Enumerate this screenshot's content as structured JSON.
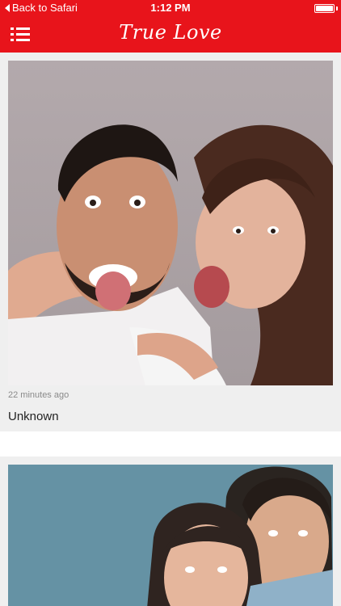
{
  "status_bar": {
    "back_label": "Back to Safari",
    "time": "1:12 PM",
    "battery_level": 1.0
  },
  "nav": {
    "title": "True Love",
    "menu_icon": "hamburger-menu-icon",
    "accent_color": "#e8141b"
  },
  "feed": {
    "posts": [
      {
        "timestamp": "22 minutes ago",
        "title": "Unknown",
        "image_icon": "couple-photo"
      },
      {
        "timestamp": "",
        "title": "",
        "image_icon": "couple-photo"
      }
    ]
  }
}
